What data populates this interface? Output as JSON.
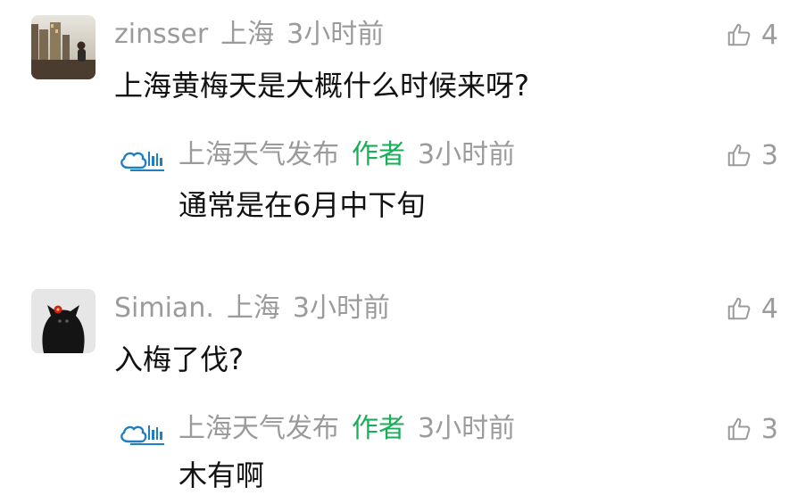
{
  "comments": [
    {
      "user": "zinsser",
      "location": "上海",
      "time": "3小时前",
      "text": "上海黄梅天是大概什么时候来呀?",
      "likes": "4",
      "reply": {
        "user": "上海天气发布",
        "tag": "作者",
        "time": "3小时前",
        "text": "通常是在6月中下旬",
        "likes": "3"
      }
    },
    {
      "user": "Simian.",
      "location": "上海",
      "time": "3小时前",
      "text": "入梅了伐?",
      "likes": "4",
      "reply": {
        "user": "上海天气发布",
        "tag": "作者",
        "time": "3小时前",
        "text": "木有啊",
        "likes": "3"
      }
    }
  ],
  "colors": {
    "meta_gray": "#9b9b9b",
    "author_tag_green": "#1aad5a",
    "logo_blue": "#1f7fc1",
    "text": "#111111"
  },
  "icons": {
    "like": "thumbs-up-icon",
    "author_logo": "shanghai-weather-logo"
  }
}
